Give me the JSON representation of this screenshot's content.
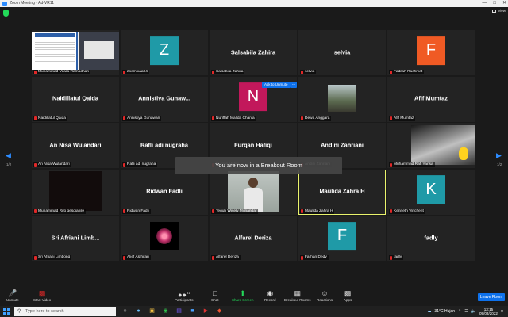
{
  "window": {
    "title": "Zoom Meeting - Ad-VR11"
  },
  "view_label": "View",
  "ask_button": "Ask to Unmute",
  "ask_more": "...",
  "banner": "You are now in a Breakout Room",
  "pagination": {
    "left": "1/2",
    "right": "1/2"
  },
  "tiles": [
    {
      "label": "Muhammad Veara Ramadhan",
      "type": "screen"
    },
    {
      "label": "zoom iiaa04",
      "type": "avatar",
      "letter": "Z",
      "color": "#1f9aa7"
    },
    {
      "label": "Salsabila Zahira",
      "big": "Salsabila Zahira",
      "type": "name"
    },
    {
      "label": "selvia",
      "big": "selvia",
      "type": "name"
    },
    {
      "label": "Fadilah Rachmat",
      "type": "avatar",
      "letter": "F",
      "color": "#f05a24"
    },
    {
      "label": "Naidillatul Qaida",
      "big": "Naidillatul Qaida",
      "type": "name"
    },
    {
      "label": "Annistiya Gunawan",
      "big": "Annistiya  Gunaw...",
      "type": "name"
    },
    {
      "label": "Nuriffah Malida Chania",
      "type": "avatar",
      "letter": "N",
      "color": "#c2185b"
    },
    {
      "label": "Dewa Anggara",
      "type": "photo"
    },
    {
      "label": "Afif Mumtaz",
      "big": "Afif Mumtaz",
      "type": "name"
    },
    {
      "label": "An Nisa Wulandari",
      "big": "An Nisa Wulandari",
      "type": "name"
    },
    {
      "label": "Rafli adi nugraha",
      "big": "Rafli adi nugraha",
      "type": "name"
    },
    {
      "label": "Furqan Hafiqi",
      "big": "Furqan Hafiqi",
      "type": "name"
    },
    {
      "label": "Andini Zahriani",
      "big": "Andini Zahriani",
      "type": "name"
    },
    {
      "label": "Muhammad Rafi Yansa",
      "type": "car"
    },
    {
      "label": "Muhammad Rifo gesdianile",
      "type": "dark"
    },
    {
      "label": "Ridwan Fadli",
      "big": "Ridwan Fadli",
      "type": "name"
    },
    {
      "label": "Teguh Wisely Munandar",
      "type": "person"
    },
    {
      "label": "Maulida Zahra H",
      "big": "Maulida Zahra H",
      "type": "name",
      "active": true
    },
    {
      "label": "Kenneth Vincherit",
      "type": "avatar",
      "letter": "K",
      "color": "#1f9aa7"
    },
    {
      "label": "Sri Afriani Limbong",
      "big": "Sri  Afriani  Limb...",
      "type": "name"
    },
    {
      "label": "Alief Alghifari",
      "type": "mandala"
    },
    {
      "label": "Alfarel Deriza",
      "big": "Alfarel Deriza",
      "type": "name"
    },
    {
      "label": "Farhan Dedy",
      "type": "avatar",
      "letter": "F",
      "color": "#1f9aa7"
    },
    {
      "label": "fadly",
      "big": "fadly",
      "type": "name"
    }
  ],
  "toolbar": {
    "unmute": "Unmute",
    "start_video": "Start Video",
    "participants": "Participants",
    "participants_count": "31",
    "chat": "Chat",
    "share": "Share Screen",
    "record": "Record",
    "breakout": "Breakout Rooms",
    "reactions": "Reactions",
    "apps": "Apps",
    "leave": "Leave Room"
  },
  "taskbar": {
    "search_placeholder": "Type here to search",
    "weather": "31°C  Hujan",
    "time": "13:15",
    "date": "09/03/2022"
  }
}
